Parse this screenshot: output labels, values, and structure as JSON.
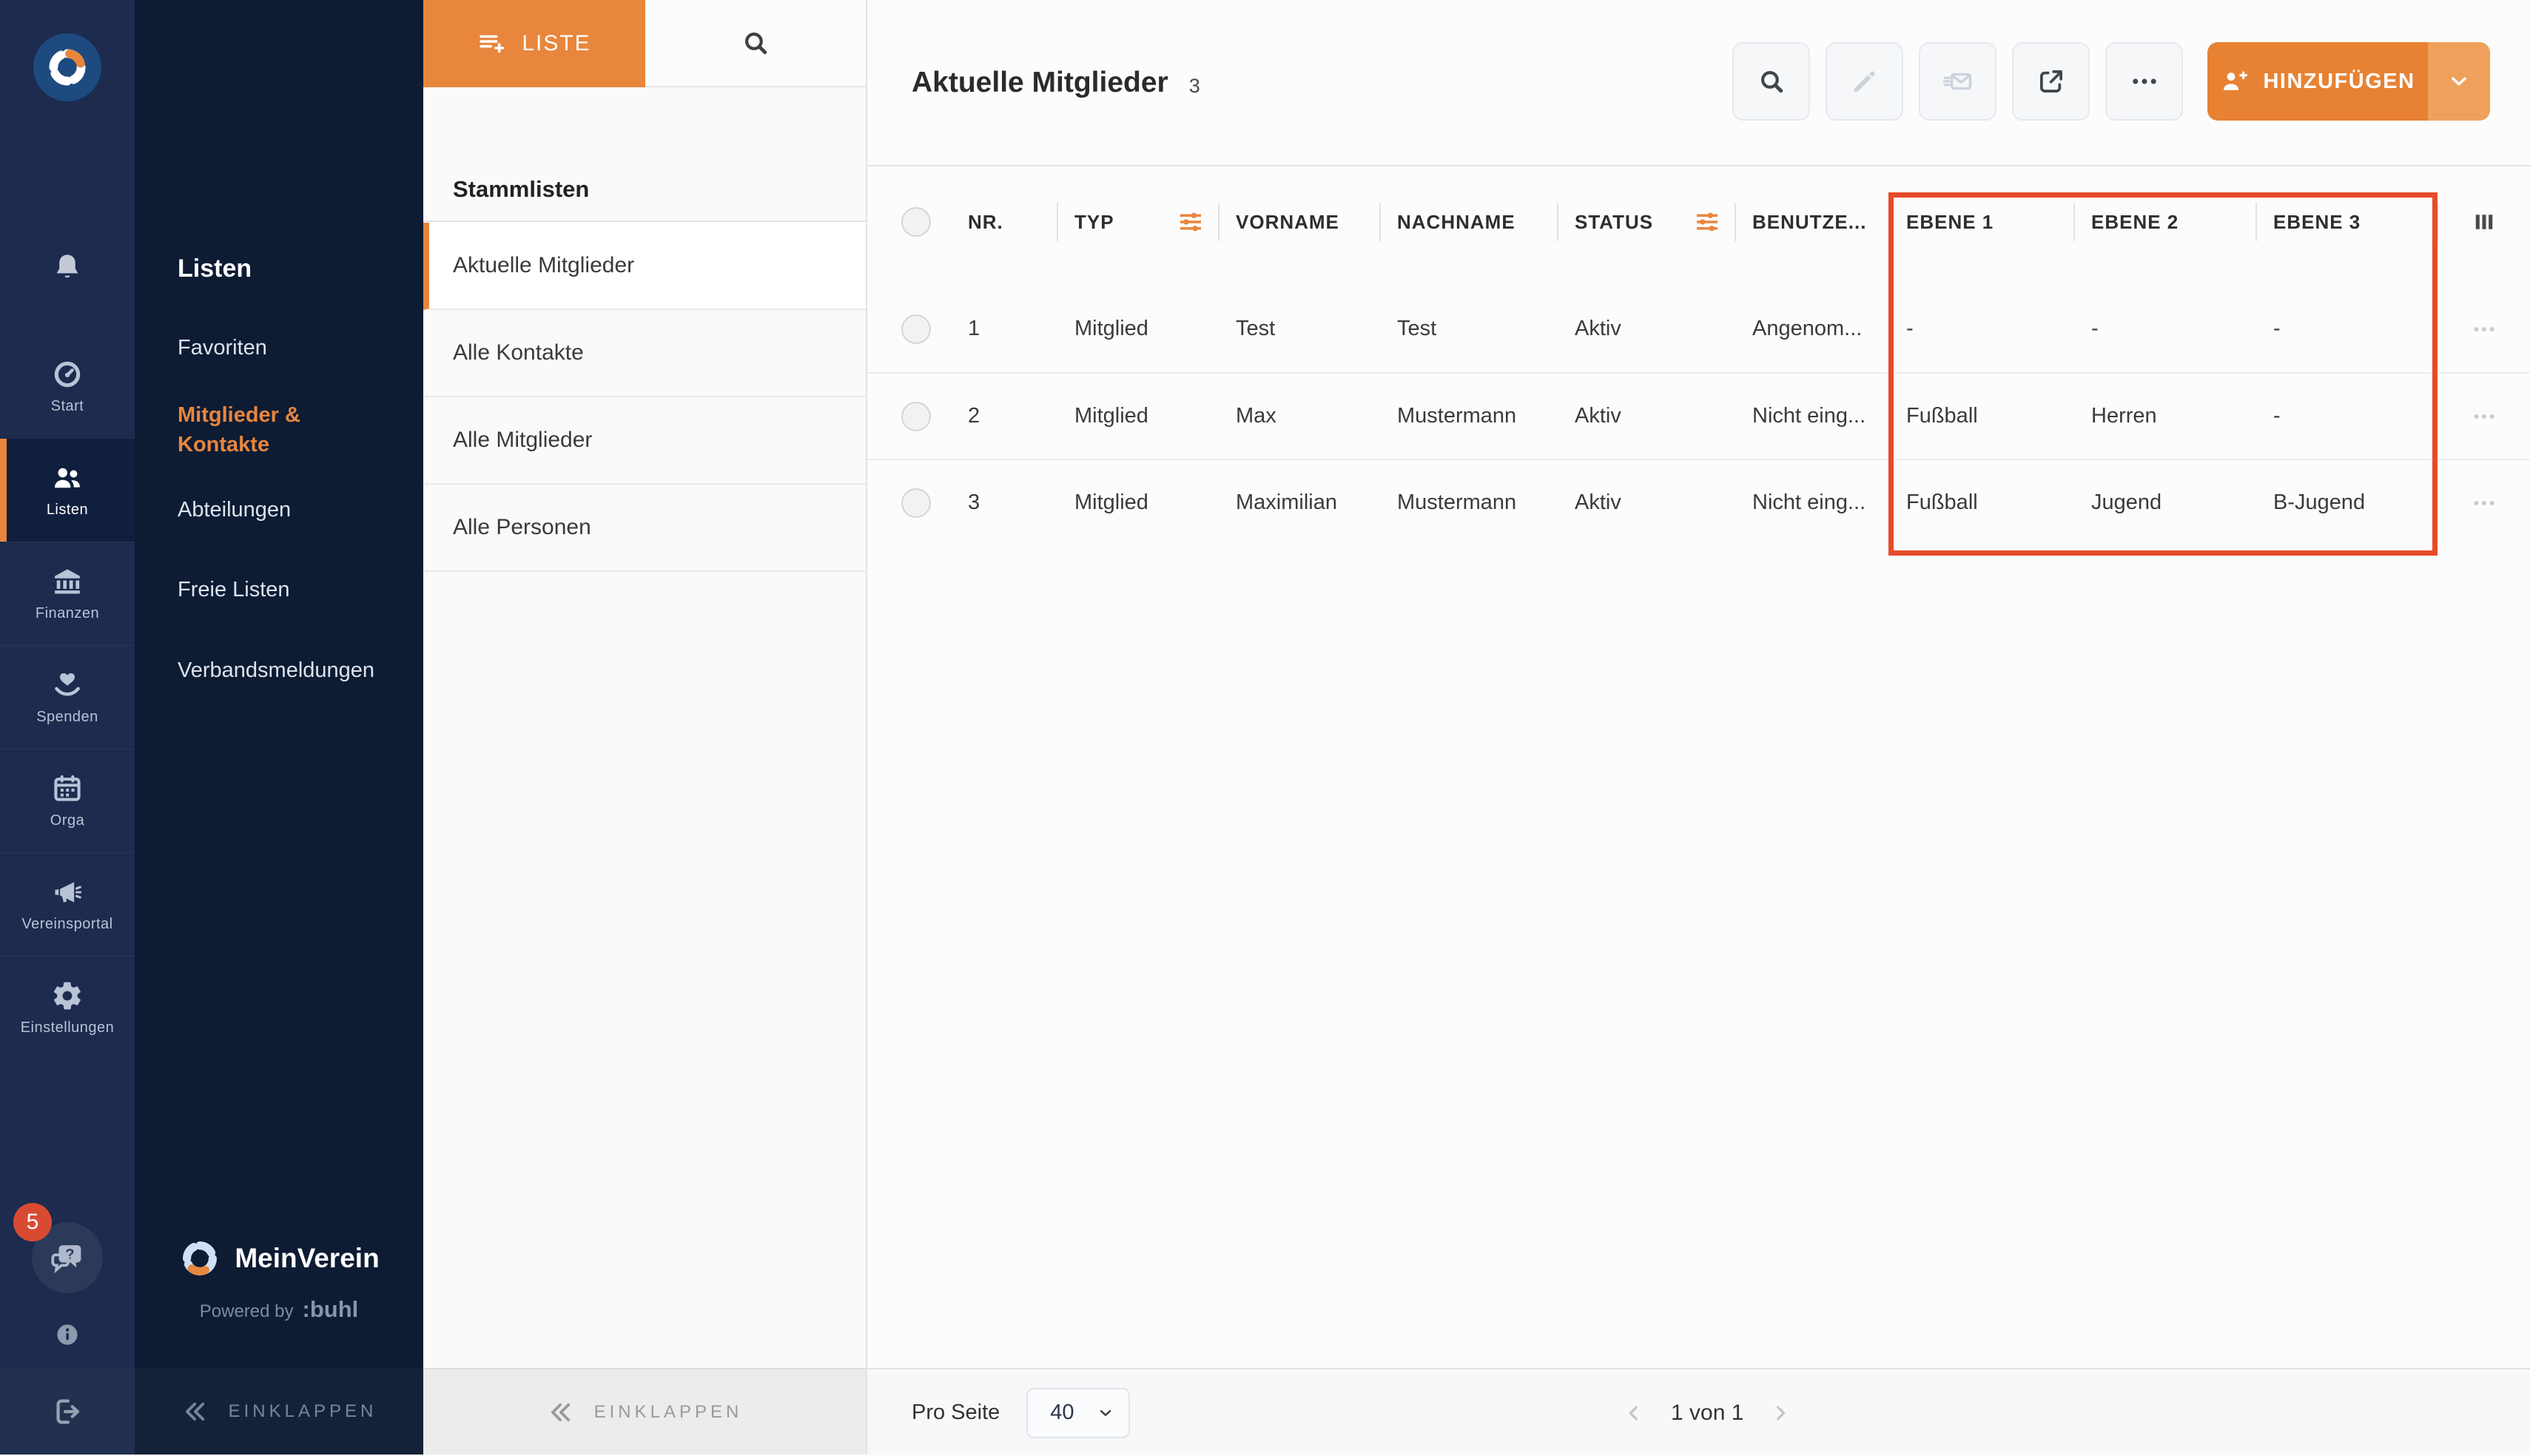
{
  "colors": {
    "rail_bg": "#1c2b4e",
    "panel_bg": "#0d1b33",
    "accent_orange": "#e8863d",
    "add_button_orange": "#e78233",
    "annotation_red": "#e64b2b",
    "badge_red": "#d84b32"
  },
  "rail": {
    "items": [
      {
        "label": "Start",
        "icon": "dashboard-icon",
        "active": false
      },
      {
        "label": "Listen",
        "icon": "people-icon",
        "active": true
      },
      {
        "label": "Finanzen",
        "icon": "bank-icon",
        "active": false
      },
      {
        "label": "Spenden",
        "icon": "donate-icon",
        "active": false
      },
      {
        "label": "Orga",
        "icon": "calendar-icon",
        "active": false
      },
      {
        "label": "Vereinsportal",
        "icon": "megaphone-icon",
        "active": false
      },
      {
        "label": "Einstellungen",
        "icon": "gear-icon",
        "active": false
      }
    ],
    "badge": "5"
  },
  "lists_panel": {
    "title": "Listen",
    "items": [
      {
        "label": "Favoriten",
        "active": false
      },
      {
        "label": "Mitglieder & Kontakte",
        "active": true
      },
      {
        "label": "Abteilungen",
        "active": false
      },
      {
        "label": "Freie Listen",
        "active": false
      },
      {
        "label": "Verbandsmeldungen",
        "active": false
      }
    ],
    "brand": "MeinVerein",
    "powered_by": "Powered by",
    "powered_brand": ":buhl",
    "collapse_label": "EINKLAPPEN"
  },
  "stamm_panel": {
    "liste_button": "LISTE",
    "section_title": "Stammlisten",
    "items": [
      {
        "label": "Aktuelle Mitglieder",
        "active": true
      },
      {
        "label": "Alle Kontakte",
        "active": false
      },
      {
        "label": "Alle Mitglieder",
        "active": false
      },
      {
        "label": "Alle Personen",
        "active": false
      }
    ],
    "collapse_label": "EINKLAPPEN"
  },
  "main": {
    "title": "Aktuelle Mitglieder",
    "count": "3",
    "add_button": "HINZUFÜGEN",
    "table": {
      "columns": [
        "NR.",
        "TYP",
        "VORNAME",
        "NACHNAME",
        "STATUS",
        "BENUTZE...",
        "EBENE 1",
        "EBENE 2",
        "EBENE 3"
      ],
      "rows": [
        {
          "nr": "1",
          "typ": "Mitglied",
          "vorname": "Test",
          "nachname": "Test",
          "status": "Aktiv",
          "benutzer": "Angenom...",
          "ebene1": "-",
          "ebene2": "-",
          "ebene3": "-"
        },
        {
          "nr": "2",
          "typ": "Mitglied",
          "vorname": "Max",
          "nachname": "Mustermann",
          "status": "Aktiv",
          "benutzer": "Nicht eing...",
          "ebene1": "Fußball",
          "ebene2": "Herren",
          "ebene3": "-"
        },
        {
          "nr": "3",
          "typ": "Mitglied",
          "vorname": "Maximilian",
          "nachname": "Mustermann",
          "status": "Aktiv",
          "benutzer": "Nicht eing...",
          "ebene1": "Fußball",
          "ebene2": "Jugend",
          "ebene3": "B-Jugend"
        }
      ]
    },
    "footer": {
      "per_page_label": "Pro Seite",
      "per_page_value": "40",
      "pagination": "1 von 1"
    }
  }
}
